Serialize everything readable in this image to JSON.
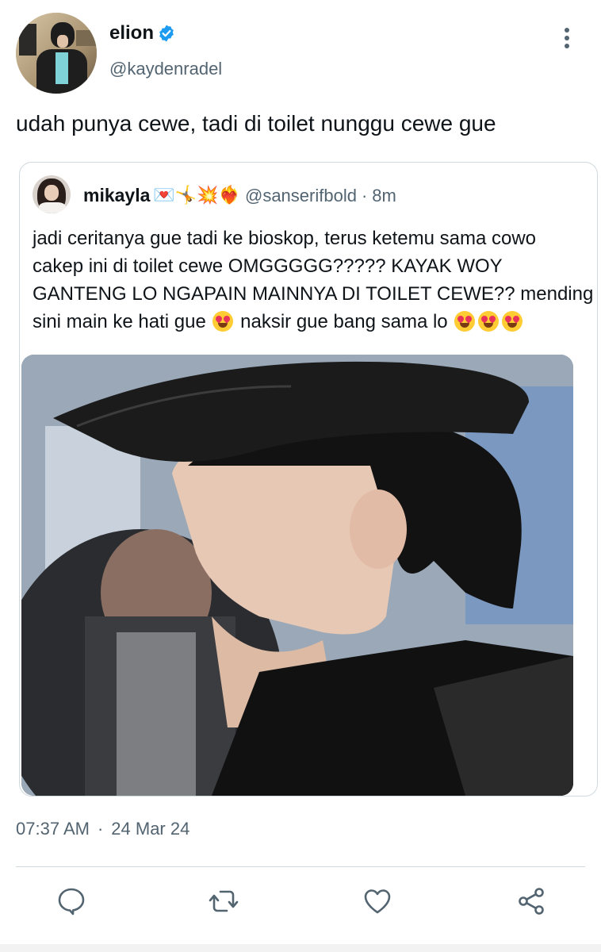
{
  "author": {
    "display_name": "elion",
    "handle": "@kaydenradel",
    "verified": true
  },
  "tweet": {
    "text": "udah punya cewe, tadi di toilet nunggu cewe gue",
    "time": "07:37 AM",
    "separator": "·",
    "date": "24 Mar 24"
  },
  "quote": {
    "display_name": "mikayla",
    "name_emojis": "💌🤸💥❤️‍🔥",
    "handle": "@sanserifbold",
    "separator": "·",
    "time": "8m",
    "text_lines": [
      "jadi ceritanya gue tadi ke bioskop, terus ketemu sama cowo",
      "cakep ini di toilet cewe OMGGGGG????? KAYAK WOY",
      "GANTENG LO NGAPAIN MAINNYA DI TOILET CEWE?? mending",
      "sini main ke hati gue",
      "naksir gue bang sama lo"
    ]
  },
  "actions": [
    "reply-icon",
    "retweet-icon",
    "like-icon",
    "share-icon"
  ],
  "colors": {
    "text": "#0f1419",
    "secondary": "#536471",
    "verified": "#1d9bf0",
    "border": "#cfd9de"
  }
}
